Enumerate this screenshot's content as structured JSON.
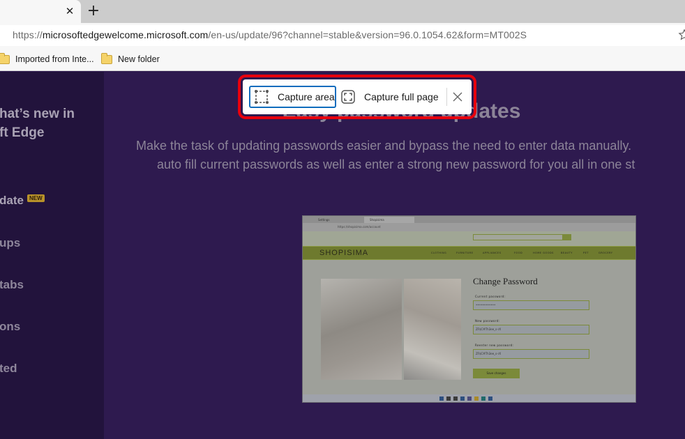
{
  "browser": {
    "tab": {
      "close_icon": "close-icon"
    },
    "new_tab_icon": "plus-icon",
    "address": {
      "scheme": "https://",
      "host": "microsoftedgewelcome.microsoft.com",
      "path": "/en-us/update/96?channel=stable&version=96.0.1054.62&form=MT002S"
    },
    "favorite_icon": "star-icon",
    "bookmarks": [
      {
        "label": "Imported from Inte...",
        "icon": "folder-icon"
      },
      {
        "label": "New folder",
        "icon": "folder-icon"
      }
    ]
  },
  "sidebar": {
    "title_line1": "hat’s new in",
    "title_line2": "ft Edge",
    "items": [
      {
        "label": "date",
        "badge": "NEW",
        "active": true
      },
      {
        "label": "ups"
      },
      {
        "label": "tabs"
      },
      {
        "label": "ons"
      },
      {
        "label": "ted"
      }
    ]
  },
  "main": {
    "headline": "Easy password updates",
    "body_line1": "Make the task of updating passwords easier and bypass the need to enter data manually.",
    "body_line2": "auto fill current passwords as well as enter a strong new password for you all in one st"
  },
  "embedded_screenshot": {
    "tab1": "Settings",
    "tab2": "Shopisima",
    "address": "https://shopisima.com/account",
    "logo": "SHOPISIMA",
    "nav": [
      "CLOTHING",
      "FURNITURE",
      "APPLIANCES",
      "FOOD",
      "HOME GOODS",
      "BEAUTY",
      "PET",
      "GROCERY"
    ],
    "form_title": "Change Password",
    "current_label": "Current password:",
    "current_value": "••••••••••••",
    "new_label": "New password:",
    "new_value": "ZF$C#Th3ee_s-rX",
    "reenter_label": "Reenter new password:",
    "reenter_value": "ZF$C#Th3ee_s-rX",
    "save_label": "Save changes"
  },
  "capture_toolbar": {
    "capture_area_label": "Capture area",
    "capture_area_icon": "capture-area-icon",
    "capture_full_label": "Capture full page",
    "capture_full_icon": "capture-full-page-icon",
    "close_icon": "close-icon",
    "highlight_color": "#e8000d",
    "accent_color": "#0f6cbd"
  }
}
